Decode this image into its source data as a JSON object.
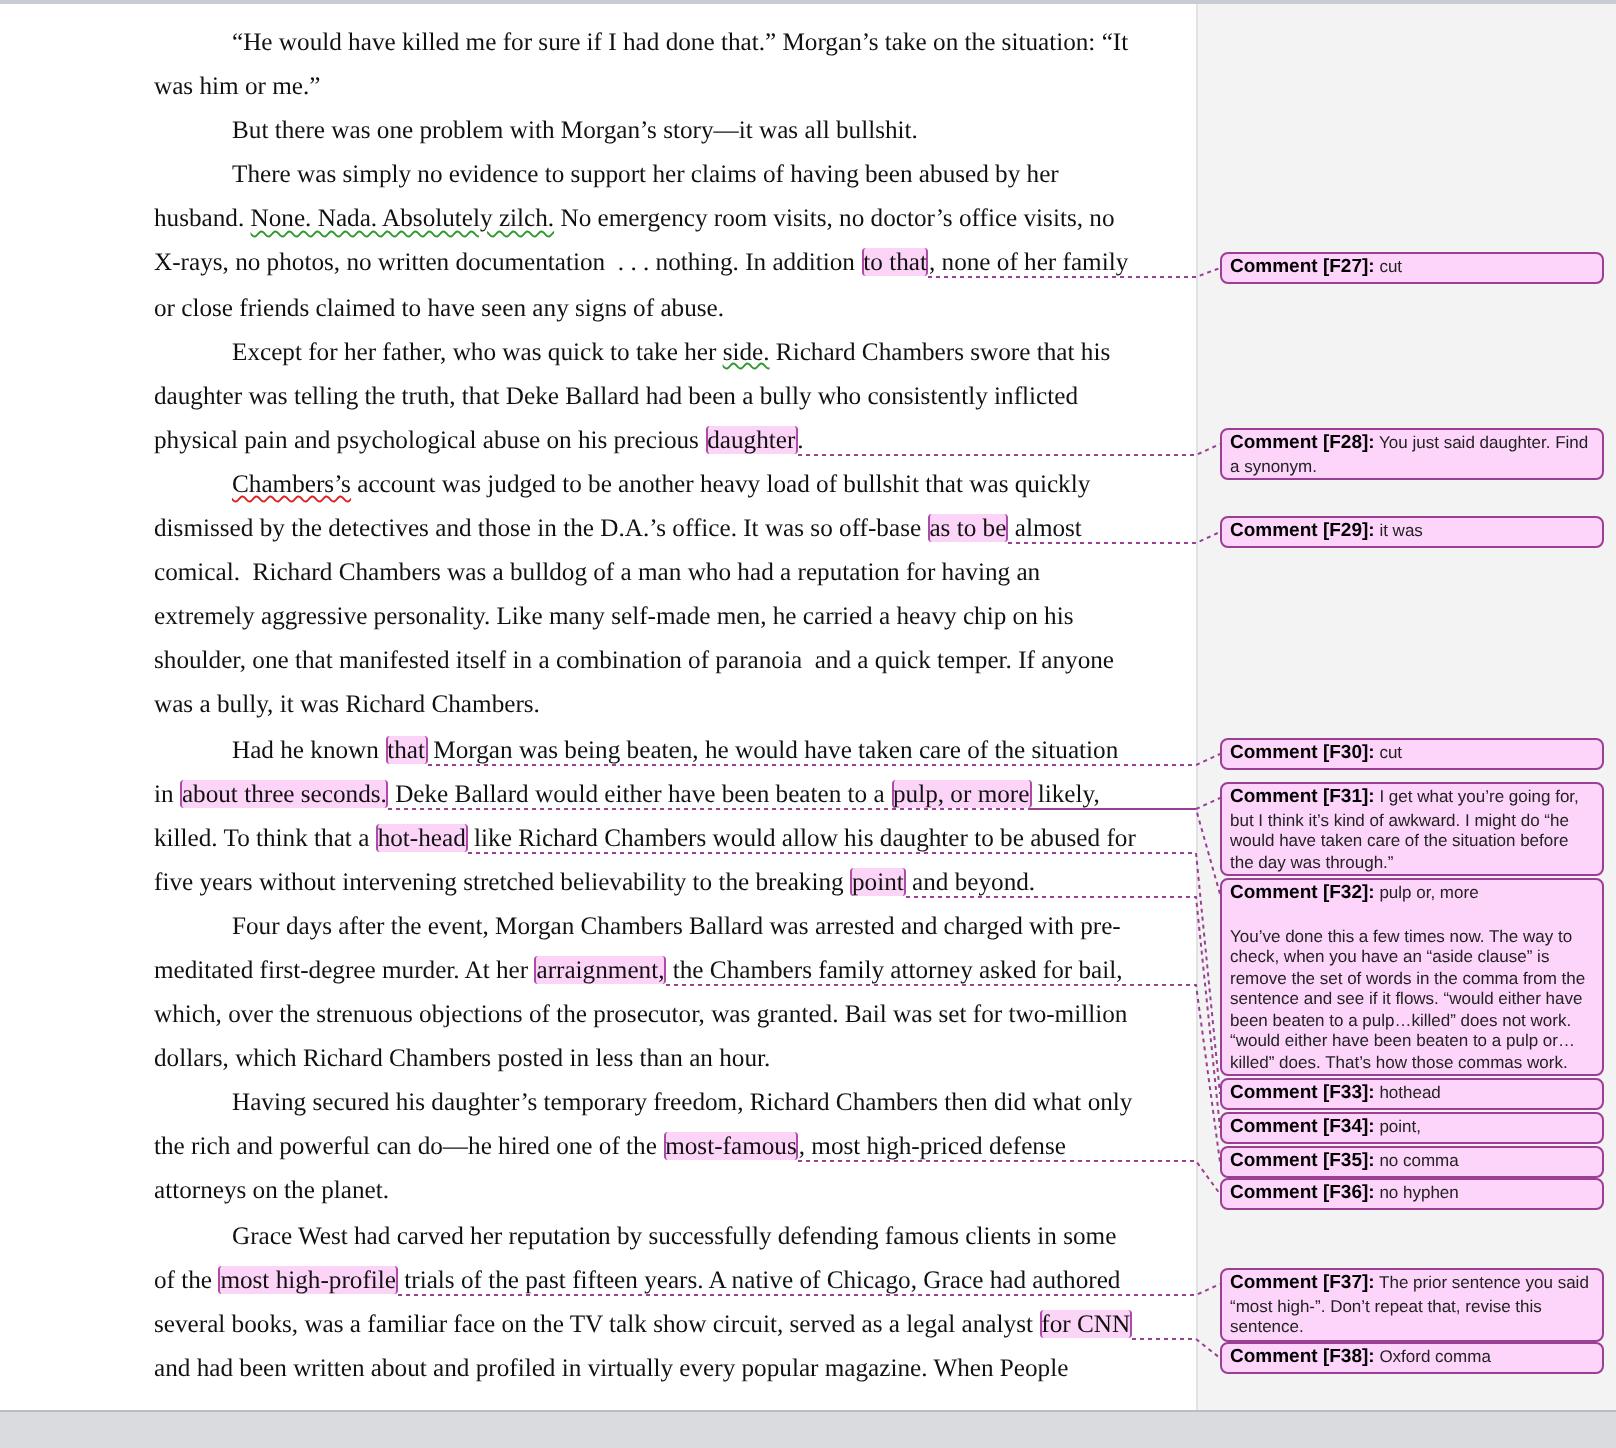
{
  "document": {
    "lines": [
      {
        "indent": true,
        "segments": [
          {
            "text": "“He would have killed me for sure if I had done that.” Morgan’s take on the situation: “It"
          }
        ]
      },
      {
        "indent": false,
        "segments": [
          {
            "text": "was him or me.”"
          }
        ]
      },
      {
        "indent": true,
        "segments": [
          {
            "text": "But there was one problem with Morgan’s story—it was all bullshit."
          }
        ]
      },
      {
        "indent": true,
        "segments": [
          {
            "text": "There was simply no evidence to support her claims of having been abused by her"
          }
        ]
      },
      {
        "indent": false,
        "segments": [
          {
            "text": "husband. "
          },
          {
            "text": "None. Nada. Absolutely zilch.",
            "grammar_flag": true
          },
          {
            "text": " No emergency room visits, no doctor’s office visits, no"
          }
        ]
      },
      {
        "indent": false,
        "segments": [
          {
            "text": "X-rays, no photos, no written documentation  . . . nothing. In addition "
          },
          {
            "text": "to that",
            "highlighted": true
          },
          {
            "text": ", none of her family"
          }
        ]
      },
      {
        "indent": false,
        "segments": [
          {
            "text": "or close friends claimed to have seen any signs of abuse."
          }
        ]
      },
      {
        "indent": true,
        "segments": [
          {
            "text": "Except for her father, who was quick to take her "
          },
          {
            "text": "side.",
            "grammar_flag": true
          },
          {
            "text": " Richard Chambers swore that his"
          }
        ]
      },
      {
        "indent": false,
        "segments": [
          {
            "text": "daughter was telling the truth, that Deke Ballard had been a bully who consistently inflicted"
          }
        ]
      },
      {
        "indent": false,
        "segments": [
          {
            "text": "physical pain and psychological abuse on his precious "
          },
          {
            "text": "daughter",
            "highlighted": true
          },
          {
            "text": "."
          }
        ]
      },
      {
        "indent": true,
        "segments": [
          {
            "text": "Chambers’s",
            "misspelled": true
          },
          {
            "text": " account was judged to be another heavy load of bullshit that was quickly"
          }
        ]
      },
      {
        "indent": false,
        "segments": [
          {
            "text": "dismissed by the detectives and those in the D.A.’s office. It was so off-base "
          },
          {
            "text": "as to be",
            "highlighted": true
          },
          {
            "text": " almost"
          }
        ]
      },
      {
        "indent": false,
        "segments": [
          {
            "text": "comical.  Richard Chambers was a bulldog of a man who had a reputation for having an"
          }
        ]
      },
      {
        "indent": false,
        "segments": [
          {
            "text": "extremely aggressive personality. Like many self-made men, he carried a heavy chip on his"
          }
        ]
      },
      {
        "indent": false,
        "segments": [
          {
            "text": "shoulder, one that manifested itself in a combination of paranoia  and a quick temper. If anyone"
          }
        ]
      },
      {
        "indent": false,
        "segments": [
          {
            "text": "was a bully, it was Richard Chambers."
          }
        ]
      },
      {
        "indent": true,
        "segments": [
          {
            "text": "Had he known "
          },
          {
            "text": "that",
            "highlighted": true
          },
          {
            "text": " Morgan was being beaten, he would have taken care of the situation"
          }
        ]
      },
      {
        "indent": false,
        "segments": [
          {
            "text": "in "
          },
          {
            "text": "about three seconds.",
            "highlighted": true
          },
          {
            "text": " Deke Ballard would either have been beaten to a "
          },
          {
            "text": "pulp, or more",
            "highlighted": true
          },
          {
            "text": " likely,"
          }
        ]
      },
      {
        "indent": false,
        "segments": [
          {
            "text": "killed. To think that a "
          },
          {
            "text": "hot-head",
            "highlighted": true
          },
          {
            "text": " like Richard Chambers would allow his daughter to be abused for"
          }
        ]
      },
      {
        "indent": false,
        "segments": [
          {
            "text": "five years without intervening stretched believability to the breaking "
          },
          {
            "text": "point",
            "highlighted": true
          },
          {
            "text": " and beyond."
          }
        ]
      },
      {
        "indent": true,
        "segments": [
          {
            "text": "Four days after the event, Morgan Chambers Ballard was arrested and charged with pre-"
          }
        ]
      },
      {
        "indent": false,
        "segments": [
          {
            "text": "meditated first-degree murder. At her "
          },
          {
            "text": "arraignment,",
            "highlighted": true
          },
          {
            "text": " the Chambers family attorney asked for bail,"
          }
        ]
      },
      {
        "indent": false,
        "segments": [
          {
            "text": "which, over the strenuous objections of the prosecutor, was granted. Bail was set for two-million"
          }
        ]
      },
      {
        "indent": false,
        "segments": [
          {
            "text": "dollars, which Richard Chambers posted in less than an hour."
          }
        ]
      },
      {
        "indent": true,
        "segments": [
          {
            "text": "Having secured his daughter’s temporary freedom, Richard Chambers then did what only"
          }
        ]
      },
      {
        "indent": false,
        "segments": [
          {
            "text": "the rich and powerful can do—he hired one of the "
          },
          {
            "text": "most-famous",
            "highlighted": true
          },
          {
            "text": ", most high-priced defense"
          }
        ]
      },
      {
        "indent": false,
        "segments": [
          {
            "text": "attorneys on the planet."
          }
        ]
      },
      {
        "indent": true,
        "segments": [
          {
            "text": "Grace West had carved her reputation by successfully defending famous clients in some"
          }
        ]
      },
      {
        "indent": false,
        "segments": [
          {
            "text": "of the "
          },
          {
            "text": "most high-profile",
            "highlighted": true
          },
          {
            "text": " trials of the past fifteen years. A native of Chicago, Grace had authored"
          }
        ]
      },
      {
        "indent": false,
        "segments": [
          {
            "text": "several books, was a familiar face on the TV talk show circuit, served as a legal analyst "
          },
          {
            "text": "for CNN",
            "highlighted": true
          }
        ]
      },
      {
        "indent": false,
        "segments": [
          {
            "text": "and had been written about and profiled in virtually every popular magazine. When People"
          }
        ]
      }
    ]
  },
  "comments": [
    {
      "label": "Comment [F27]:",
      "body": [
        "cut"
      ]
    },
    {
      "label": "Comment [F28]:",
      "body": [
        "You just said daughter.  Find a synonym."
      ]
    },
    {
      "label": "Comment [F29]:",
      "body": [
        "it was"
      ]
    },
    {
      "label": "Comment [F30]:",
      "body": [
        "cut"
      ]
    },
    {
      "label": "Comment [F31]:",
      "body": [
        "I get what you’re going for, but I think it’s kind of awkward.  I might do “he would have taken care of the situation before the day was through.”"
      ]
    },
    {
      "label": "Comment [F32]:",
      "body": [
        "pulp or, more",
        "You’ve done this a few times now.  The way to check, when you have an “aside clause” is remove the set of words in the comma from the sentence and see if it flows.  “would either have been beaten to a pulp…killed” does not work.  “would either have been beaten to a pulp or…killed” does. That’s how those commas work."
      ]
    },
    {
      "label": "Comment [F33]:",
      "body": [
        "hothead"
      ]
    },
    {
      "label": "Comment [F34]:",
      "body": [
        "point,"
      ]
    },
    {
      "label": "Comment [F35]:",
      "body": [
        "no comma"
      ]
    },
    {
      "label": "Comment [F36]:",
      "body": [
        "no hyphen"
      ]
    },
    {
      "label": "Comment [F37]:",
      "body": [
        "The prior sentence you said “most high-”. Don’t repeat that, revise this sentence."
      ]
    },
    {
      "label": "Comment [F38]:",
      "body": [
        "Oxford comma"
      ]
    }
  ]
}
